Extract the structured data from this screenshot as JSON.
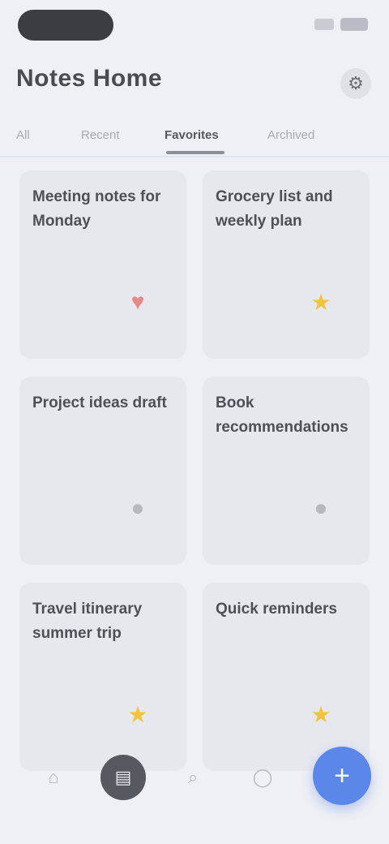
{
  "header": {
    "title": "Notes Home",
    "action_icon": "settings-icon"
  },
  "tabs": [
    {
      "label": "All"
    },
    {
      "label": "Recent"
    },
    {
      "label": "Favorites"
    },
    {
      "label": "Archived"
    }
  ],
  "cards": [
    {
      "title": "Meeting notes for Monday",
      "icon": "heart-icon",
      "icon_color": "#e58a86"
    },
    {
      "title": "Grocery list and weekly plan",
      "icon": "star-icon",
      "icon_color": "#f0c43c"
    },
    {
      "title": "Project ideas draft",
      "icon": "pin-icon",
      "icon_color": "#b6b8be"
    },
    {
      "title": "Book recommendations",
      "icon": "pin-icon",
      "icon_color": "#b6b8be"
    },
    {
      "title": "Travel itinerary summer trip",
      "icon": "star-icon",
      "icon_color": "#f0c43c"
    },
    {
      "title": "Quick reminders",
      "icon": "star-icon",
      "icon_color": "#f0c43c"
    }
  ],
  "bottom_nav": {
    "items": [
      {
        "icon": "home-icon"
      },
      {
        "icon": "notes-icon"
      },
      {
        "icon": "search-icon"
      },
      {
        "icon": "profile-icon"
      }
    ],
    "fab_icon": "plus-icon",
    "accent": "#5b86ea"
  }
}
